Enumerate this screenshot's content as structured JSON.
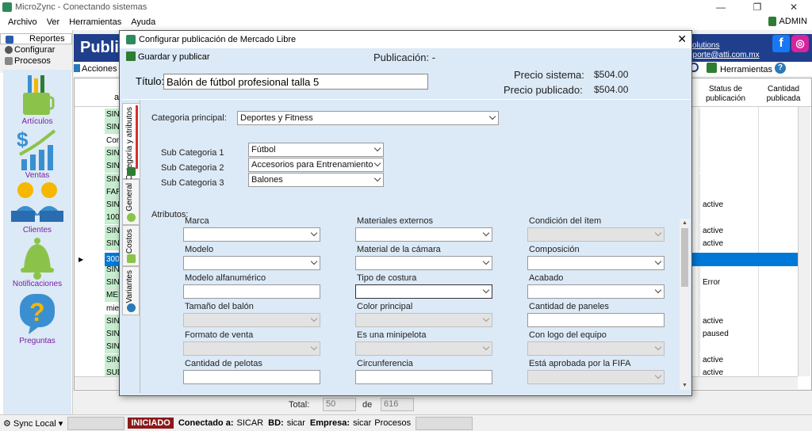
{
  "window": {
    "title": "MicroZync - Conectando sistemas",
    "minimize": "—",
    "maximize": "❐",
    "close": "✕"
  },
  "menu": {
    "items": [
      "Archivo",
      "Ver",
      "Herramientas",
      "Ayuda"
    ],
    "user": "ADMIN"
  },
  "leftnav": {
    "top": [
      "Reportes",
      "Configurar",
      "Procesos"
    ],
    "items": [
      "Artículos",
      "Ventas",
      "Clientes",
      "Notificaciones",
      "Preguntas"
    ]
  },
  "main": {
    "title": "Publica",
    "solutions": "olutions",
    "email": "soporte@atti.com.mx",
    "acciones": "Acciones",
    "herramientas": "Herramientas ▾",
    "grid": {
      "col_a": "a",
      "col_status": "Status de publicación",
      "col_cant": "Cantidad publicada",
      "cells": [
        "SINS",
        "SINS",
        "Com",
        "SINS",
        "SINS",
        "SINS",
        "FAR",
        "SINS",
        "100",
        "SINS",
        "SINS",
        "300",
        "SINS",
        "SINS",
        "MEI",
        "mie",
        "SINS",
        "SINS",
        "SINS",
        "SINS",
        "SUD"
      ],
      "statuses": [
        "",
        "",
        "",
        "",
        "",
        "",
        "",
        "active",
        "",
        "active",
        "active",
        "",
        "",
        "Error",
        "",
        "",
        "active",
        "paused",
        "",
        "active",
        "active"
      ]
    },
    "totals": {
      "label": "Total:",
      "count": "50",
      "de": "de",
      "total": "616"
    }
  },
  "statusbar": {
    "sync": "Sync Local",
    "iniciado": "INICIADO",
    "conectado_lbl": "Conectado a:",
    "conectado": "SICAR",
    "bd_lbl": "BD:",
    "bd": "sicar",
    "empresa_lbl": "Empresa:",
    "empresa": "sicar",
    "procesos": "Procesos"
  },
  "dialog": {
    "title": "Configurar publicación de Mercado Libre",
    "save": "Guardar y publicar",
    "publicacion": "Publicación:  -",
    "titulo_label": "Título:",
    "titulo_value": "Balón de fútbol profesional talla 5",
    "precio_sistema_label": "Precio sistema:",
    "precio_sistema": "$504.00",
    "precio_publicado_label": "Precio publicado:",
    "precio_publicado": "$504.00",
    "tabs": [
      "Categoría y atributos",
      "General",
      "Costos",
      "Variantes"
    ],
    "categoria_label": "Categoria principal:",
    "categoria_value": "Deportes y Fitness",
    "sub1_label": "Sub Categoria 1",
    "sub1_value": "Fútbol",
    "sub2_label": "Sub Categoria 2",
    "sub2_value": "Accesorios para Entrenamiento",
    "sub3_label": "Sub Categoria 3",
    "sub3_value": "Balones",
    "atributos_label": "Atributos:",
    "attrs": [
      "Marca",
      "Materiales externos",
      "Condición del ítem",
      "Modelo",
      "Material de la cámara",
      "Composición",
      "Modelo alfanumérico",
      "Tipo de costura",
      "Acabado",
      "Tamaño del balón",
      "Color principal",
      "Cantidad de paneles",
      "Formato de venta",
      "Es una minipelota",
      "Con logo del equipo",
      "Cantidad de pelotas",
      "Circunferencia",
      "Está aprobada por la FIFA"
    ]
  }
}
